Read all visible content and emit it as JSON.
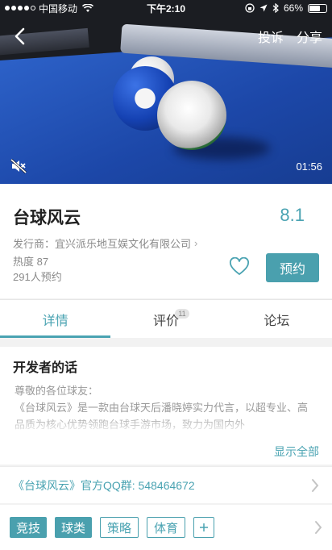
{
  "status_bar": {
    "carrier": "中国移动",
    "time": "下午2:10",
    "battery_text": "66%",
    "battery_level": 0.66
  },
  "topbar": {
    "complaint_label": "投诉",
    "share_label": "分享"
  },
  "video": {
    "duration": "01:56"
  },
  "game": {
    "title": "台球风云",
    "score": "8.1",
    "publisher": "发行商：宜兴派乐地互娱文化有限公司",
    "heat": "热度 87",
    "reservations": "291人预约",
    "reserve_label": "预约"
  },
  "tabs": [
    {
      "label": "详情",
      "active": true
    },
    {
      "label": "评价",
      "badge": "11"
    },
    {
      "label": "论坛"
    }
  ],
  "developer": {
    "heading": "开发者的话",
    "greeting": "尊敬的各位球友：",
    "body": "《台球风云》是一款由台球天后潘晓婷实力代言，以超专业、高品质为核心优势领跑台球手游市场，致力为国内外",
    "show_all": "显示全部"
  },
  "qq_group": "《台球风云》官方QQ群: 548464672",
  "tags": [
    {
      "label": "竞技",
      "style": "filled"
    },
    {
      "label": "球类",
      "style": "filled"
    },
    {
      "label": "策略",
      "style": "outline"
    },
    {
      "label": "体育",
      "style": "outline"
    }
  ],
  "colors": {
    "accent": "#4aa3b2",
    "table_blue": "#1c47a8"
  }
}
